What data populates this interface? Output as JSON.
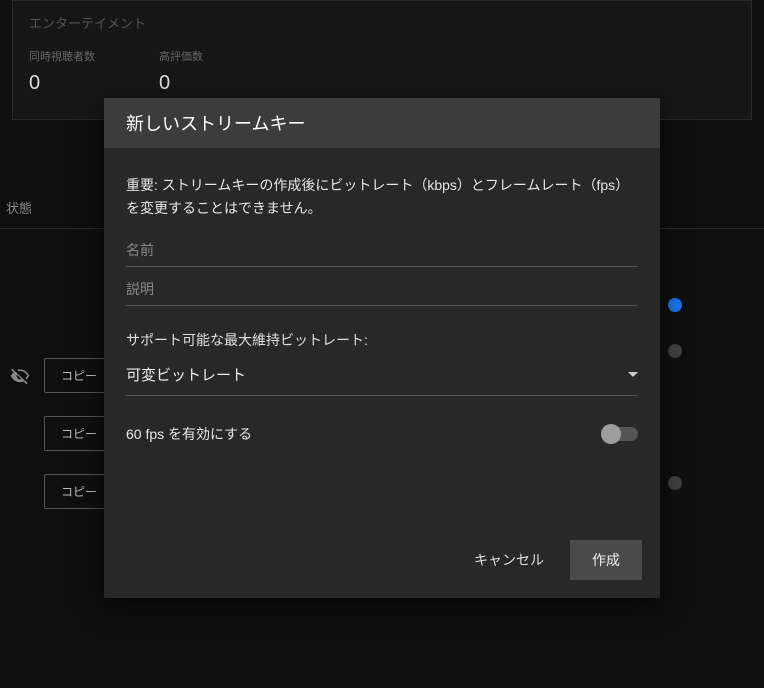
{
  "background": {
    "category_label": "エンターテイメント",
    "stats": [
      {
        "label": "同時視聴者数",
        "value": "0"
      },
      {
        "label": "高評価数",
        "value": "0"
      }
    ],
    "status_label": "状態",
    "copy_button_label": "コピー"
  },
  "modal": {
    "title": "新しいストリームキー",
    "warning": "重要: ストリームキーの作成後にビットレート（kbps）とフレームレート（fps）を変更することはできません。",
    "name_placeholder": "名前",
    "description_placeholder": "説明",
    "bitrate_label": "サポート可能な最大維持ビットレート:",
    "bitrate_value": "可変ビットレート",
    "enable_60fps_label": "60 fps を有効にする",
    "cancel_label": "キャンセル",
    "create_label": "作成"
  }
}
